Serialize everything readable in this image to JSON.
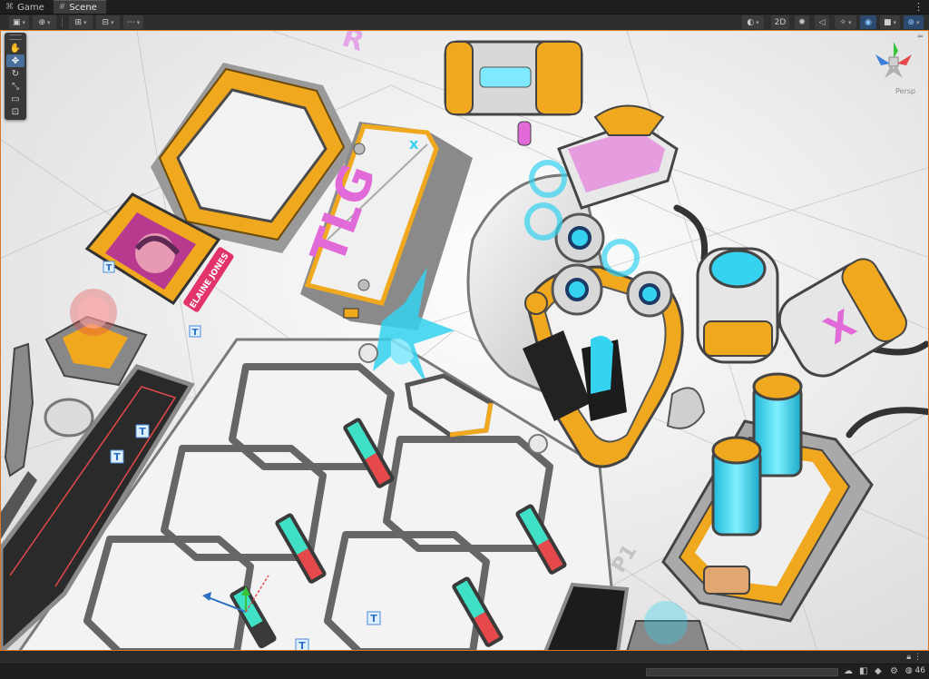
{
  "tabs": [
    {
      "label": "Game",
      "icon": "gamepad-icon",
      "active": false
    },
    {
      "label": "Scene",
      "icon": "grid-icon",
      "active": true
    }
  ],
  "tabbar_menu": "⋮",
  "toolbar": {
    "view_2d_label": "2D"
  },
  "scene": {
    "name_tag": "ELAINE JONES",
    "box_lettering": "TLG",
    "box_mark": "x",
    "text_gizmo": "T",
    "floor_marks": [
      "P1",
      "R"
    ],
    "perspective_label": "Persp"
  },
  "colors": {
    "accent_orange": "#f0a81e",
    "cyan": "#35d3f0",
    "magenta": "#e26ad8",
    "red": "#e5494b",
    "teal": "#3fe0c5",
    "selection_border": "#d9781e",
    "editor_dark": "#2e2e2e"
  },
  "statusbar": {
    "badge_count": "46",
    "progress": 0
  }
}
